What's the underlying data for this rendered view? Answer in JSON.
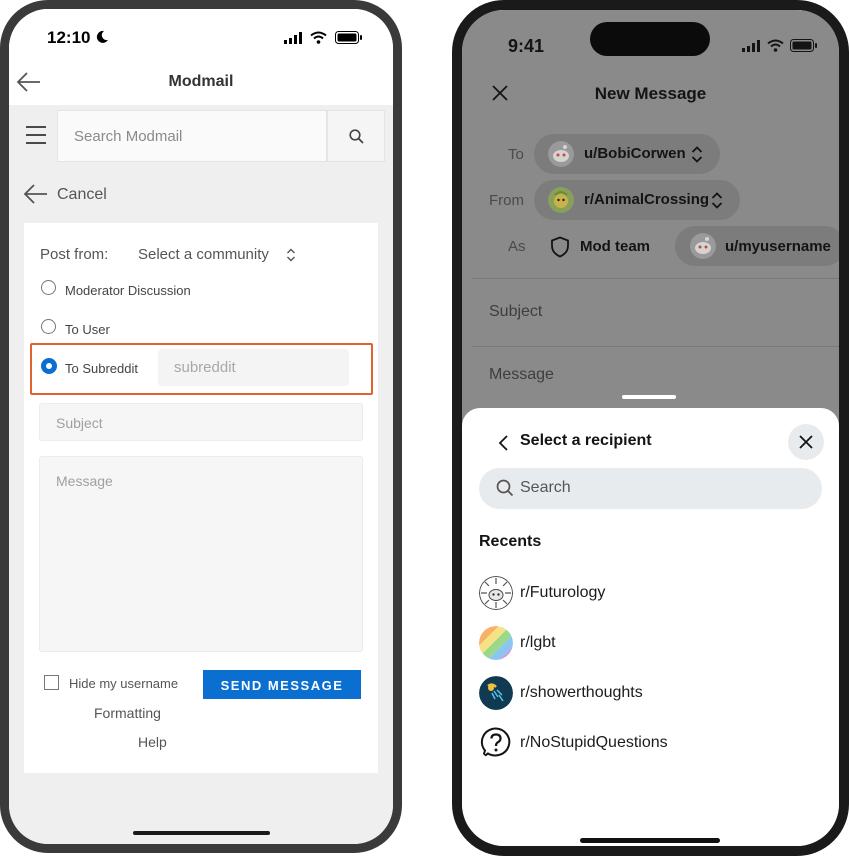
{
  "left_phone": {
    "status_time": "12:10",
    "header_title": "Modmail",
    "search_placeholder": "Search Modmail",
    "cancel_label": "Cancel",
    "post_from_label": "Post from:",
    "community_select": "Select a community",
    "options": [
      "Moderator Discussion",
      "To User",
      "To Subreddit"
    ],
    "selected_option": "To Subreddit",
    "subreddit_placeholder": "subreddit",
    "subject_placeholder": "Subject",
    "message_placeholder": "Message",
    "hide_username_label": "Hide my username",
    "send_label": "SEND MESSAGE",
    "formatting_link": "Formatting",
    "help_link": "Help",
    "colors": {
      "accent": "#0a6fd0",
      "highlight": "#e2622d"
    }
  },
  "right_phone": {
    "status_time": "9:41",
    "header_title": "New Message",
    "to_label": "To",
    "to_value": "u/BobiCorwen",
    "from_label": "From",
    "from_value": "r/AnimalCrossing",
    "as_label": "As",
    "as_mod_team": "Mod team",
    "as_user": "u/myusername",
    "subject_placeholder": "Subject",
    "message_placeholder": "Message",
    "sheet": {
      "title": "Select a recipient",
      "search_placeholder": "Search",
      "recents_heading": "Recents",
      "recents": [
        {
          "name": "r/Futurology",
          "icon": "futurology-avatar"
        },
        {
          "name": "r/lgbt",
          "icon": "rainbow-avatar"
        },
        {
          "name": "r/showerthoughts",
          "icon": "shower-avatar"
        },
        {
          "name": "r/NoStupidQuestions",
          "icon": "question-icon"
        }
      ]
    }
  }
}
